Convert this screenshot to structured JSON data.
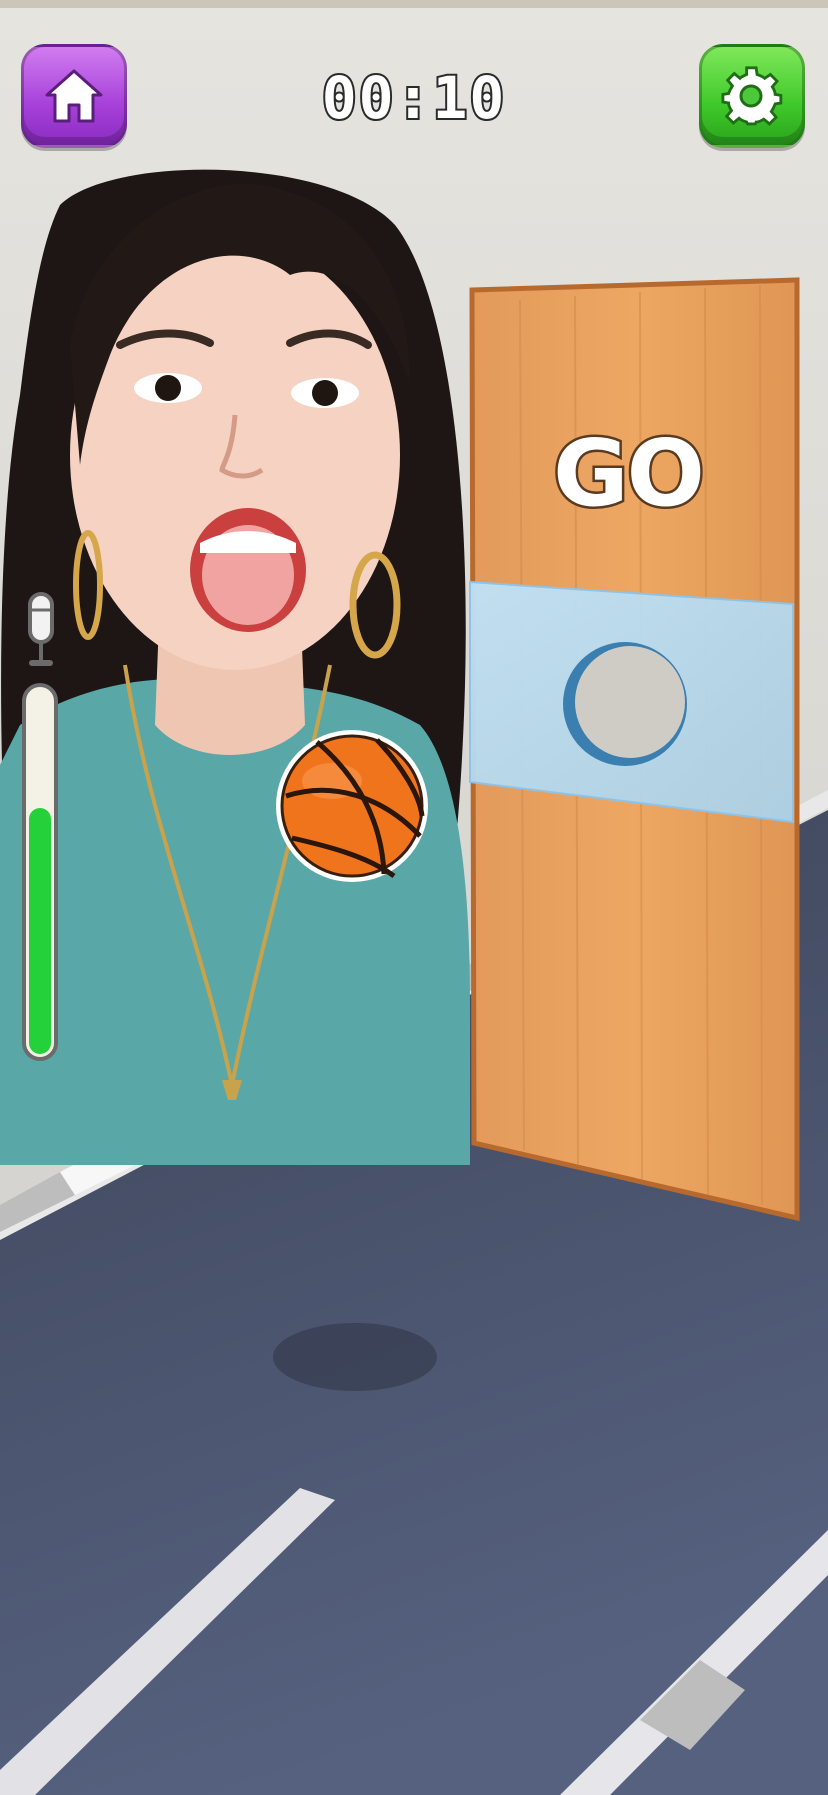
{
  "hud": {
    "timer": "00:10",
    "home_icon": "home-icon",
    "settings_icon": "gear-icon",
    "home_color": "#a640d9",
    "settings_color": "#3fc82a"
  },
  "voice_meter": {
    "icon": "microphone-icon",
    "level": 0.68,
    "fill_color": "#25d13a"
  },
  "board": {
    "label": "GO"
  },
  "ball": {
    "icon": "basketball-icon",
    "color": "#f0741c"
  }
}
